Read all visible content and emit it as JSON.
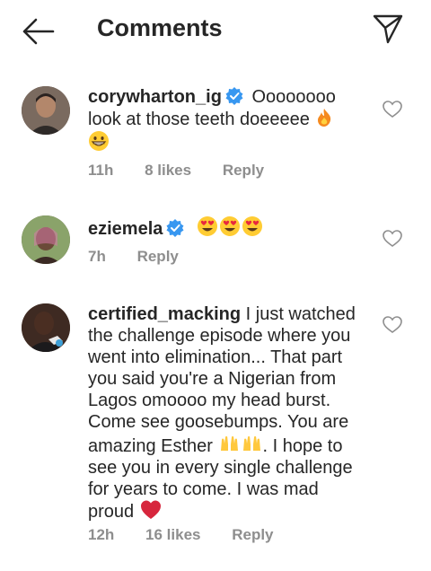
{
  "header": {
    "title": "Comments",
    "back_icon": "arrow-left-icon",
    "share_icon": "paper-plane-icon"
  },
  "comments": [
    {
      "username": "corywharton_ig",
      "verified": true,
      "text_line1": "Oooooooo",
      "text_line2": "look at those teeth doeeeee",
      "emojis": [
        "fire-icon",
        "grinning-face-icon"
      ],
      "time": "11h",
      "likes": "8 likes",
      "reply": "Reply"
    },
    {
      "username": "eziemela",
      "verified": true,
      "emojis": [
        "heart-eyes-icon",
        "heart-eyes-icon",
        "heart-eyes-icon"
      ],
      "time": "7h",
      "reply": "Reply"
    },
    {
      "username": "certified_macking",
      "verified": false,
      "text_part1": "I just watched the challenge episode where you went into elimination... That part you said you're a Nigerian from Lagos omoooo my head burst. Come see goosebumps. You are amazing Esther",
      "text_part2": ". I hope to see you in every single challenge for years to come. I was mad proud",
      "emojis": [
        "raising-hands-icon",
        "raising-hands-icon",
        "red-heart-icon"
      ],
      "time": "12h",
      "likes": "16 likes",
      "reply": "Reply"
    }
  ],
  "colors": {
    "text": "#262626",
    "meta": "#8e8e8e",
    "verified_blue": "#3897f0",
    "emoji_yellow": "#ffcc33",
    "heart_red": "#d7263d"
  }
}
